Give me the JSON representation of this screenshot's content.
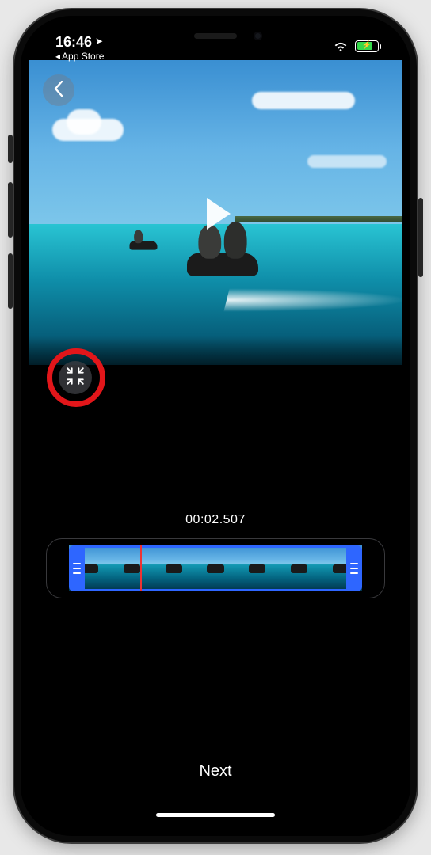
{
  "status": {
    "time": "16:46",
    "back_app_label": "App Store"
  },
  "editor": {
    "timestamp": "00:02.507",
    "next_label": "Next"
  },
  "icons": {
    "back": "chevron-left-icon",
    "play": "play-icon",
    "collapse": "collapse-icon",
    "wifi": "wifi-icon",
    "battery": "battery-charging-icon",
    "location": "location-arrow-icon",
    "trim_left": "trim-handle-left-icon",
    "trim_right": "trim-handle-right-icon"
  },
  "colors": {
    "accent_blue": "#2e66ff",
    "battery_green": "#35d94b",
    "annotation_red": "#e2161a"
  },
  "timeline": {
    "thumbnail_count": 7
  }
}
